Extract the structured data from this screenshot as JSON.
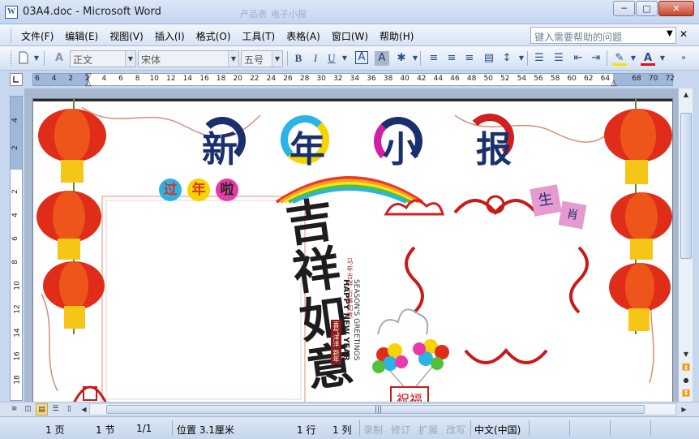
{
  "window": {
    "title": "03A4.doc - Microsoft Word",
    "app_icon_glyph": "W",
    "background_tabs": [
      "产品表",
      "电子小报"
    ],
    "controls": {
      "minimize": "─",
      "maximize": "□",
      "close": "✕"
    }
  },
  "menu": {
    "items": [
      "文件(F)",
      "编辑(E)",
      "视图(V)",
      "插入(I)",
      "格式(O)",
      "工具(T)",
      "表格(A)",
      "窗口(W)",
      "帮助(H)"
    ],
    "help_placeholder": "键入需要帮助的问题"
  },
  "toolbar": {
    "style_value": "正文",
    "font_value": "宋体",
    "size_value": "五号",
    "bold": "B",
    "italic": "I",
    "underline": "U",
    "char_border": "A",
    "char_shading": "A",
    "font_color": "A",
    "style_icon": "A"
  },
  "ruler": {
    "labels": [
      "6",
      "4",
      "2",
      "2",
      "4",
      "6",
      "8",
      "10",
      "12",
      "14",
      "16",
      "18",
      "20",
      "22",
      "24",
      "26",
      "28",
      "30",
      "32",
      "34",
      "36",
      "38",
      "40",
      "42",
      "44",
      "46",
      "48",
      "50",
      "52",
      "54",
      "56",
      "58",
      "60",
      "62",
      "64",
      "68",
      "70",
      "72"
    ],
    "vlabels": [
      "4",
      "2",
      "2",
      "4",
      "6",
      "8",
      "10",
      "12",
      "14",
      "16",
      "18"
    ]
  },
  "document": {
    "headline": [
      "新",
      "年",
      "小",
      "报"
    ],
    "tag_bubbles": [
      "过",
      "年",
      "啦"
    ],
    "zodiac": [
      "生",
      "肖"
    ],
    "calligraphy": "吉祥如意",
    "english_1": "SEASON'S GREETINGS",
    "english_2": "HAPPY NEW YEAR",
    "vertical_small": "马年吉祥 万事如意",
    "zhu_fu": "祝福",
    "seal": "喜气洋洋 新年"
  },
  "statusbar": {
    "page": "1 页",
    "section": "1 节",
    "pages": "1/1",
    "position": "位置 3.1厘米",
    "line": "1 行",
    "column": "1 列",
    "rec": "录制",
    "trk": "修订",
    "ext": "扩展",
    "ovr": "改写",
    "language": "中文(中国)"
  },
  "colors": {
    "accent": "#c7d7ee",
    "headline": "#1a2f6e",
    "lantern_red": "#e02d1a",
    "lantern_gold": "#f5c518"
  }
}
